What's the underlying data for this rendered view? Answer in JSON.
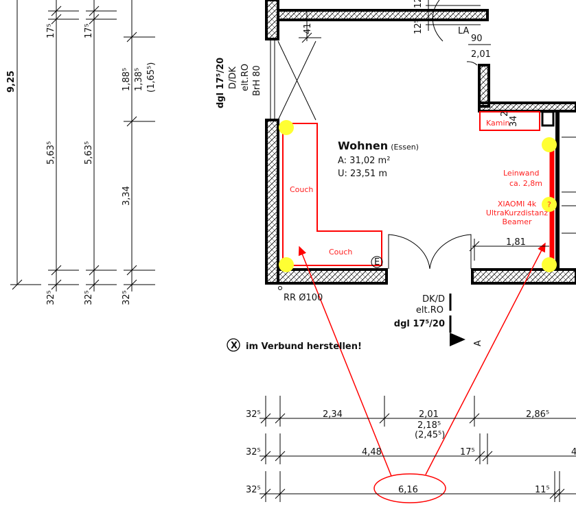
{
  "colors": {
    "annotation": "#ff0000",
    "marker": "#ffff33",
    "wall": "#000000"
  },
  "left_dims": {
    "total": "9,25",
    "top_a": "17⁵",
    "top_b": "17⁵",
    "mid_a": "5,63⁵",
    "mid_b": "5,63⁵",
    "win_1": "1,88⁵",
    "win_2": "1,38⁵",
    "win_3": "(1,65⁵)",
    "lower": "3,34",
    "bottom_a": "32⁵",
    "bottom_b": "32⁵",
    "bottom_c": "32⁵"
  },
  "window_left": {
    "line1": "dgl 17⁵/20",
    "line2": "D/DK",
    "line3": "elt.RO",
    "line4": "BrH 80"
  },
  "top_dims": {
    "d41": "41",
    "d12": "12",
    "d125": "12⁵",
    "door_type": "LA",
    "door_w": "90",
    "door_h": "2,01"
  },
  "room": {
    "name": "Wohnen",
    "sub": "(Essen)",
    "area": "A: 31,02 m²",
    "perimeter": "U: 23,51 m"
  },
  "annotations": {
    "couch1": "Couch",
    "couch2": "Couch",
    "kamin": "Kamin",
    "kamin_dim_a": "2",
    "kamin_dim_b": "34",
    "screen_1": "Leinwand",
    "screen_2": "ca. 2,8m",
    "beamer_1": "XIAOMI 4k",
    "beamer_2": "UltraKurzdistanz",
    "beamer_3": "Beamer",
    "question": "?"
  },
  "misc": {
    "e_mark": "E",
    "rr": "RR Ø100",
    "dim_181": "1,81",
    "door_bottom_1": "DK/D",
    "door_bottom_2": "elt.RO",
    "door_bottom_3": "dgl 17⁵/20",
    "section": "A",
    "x_mark": "X",
    "note": "im Verbund herstellen!"
  },
  "bottom_dims": {
    "row1": {
      "a": "32⁵",
      "b": "2,34",
      "c": "2,01",
      "c2": "2,18⁵",
      "c3": "(2,45⁵)",
      "d": "2,86⁵"
    },
    "row2": {
      "a": "32⁵",
      "b": "4,48",
      "c": "17⁵",
      "d": "4"
    },
    "row3": {
      "a": "32⁵",
      "b": "6,16",
      "c": "11⁵"
    }
  }
}
